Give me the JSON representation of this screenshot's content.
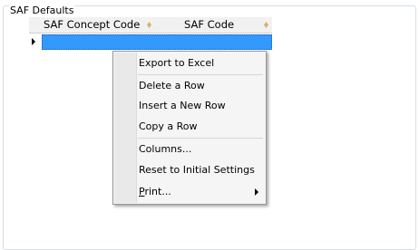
{
  "group": {
    "title": "SAF Defaults"
  },
  "grid": {
    "columns": [
      {
        "label": "SAF Concept Code",
        "sort_icon": "sort-diamond-icon"
      },
      {
        "label": "SAF Code",
        "sort_icon": "sort-diamond-icon"
      }
    ],
    "selected_row_color": "#3399ff"
  },
  "context_menu": {
    "items": [
      {
        "label": "Export to Excel"
      },
      {
        "label": "Delete a Row"
      },
      {
        "label": "Insert a New Row"
      },
      {
        "label": "Copy a Row"
      },
      {
        "label": "Columns..."
      },
      {
        "label": "Reset to Initial Settings"
      },
      {
        "label_prefix": "P",
        "label_rest": "rint...",
        "submenu": true
      }
    ]
  },
  "colors": {
    "header_bg": "#f1f1f1",
    "menu_bg": "#f5f5f5",
    "sort_icon": "#d6b36a"
  }
}
